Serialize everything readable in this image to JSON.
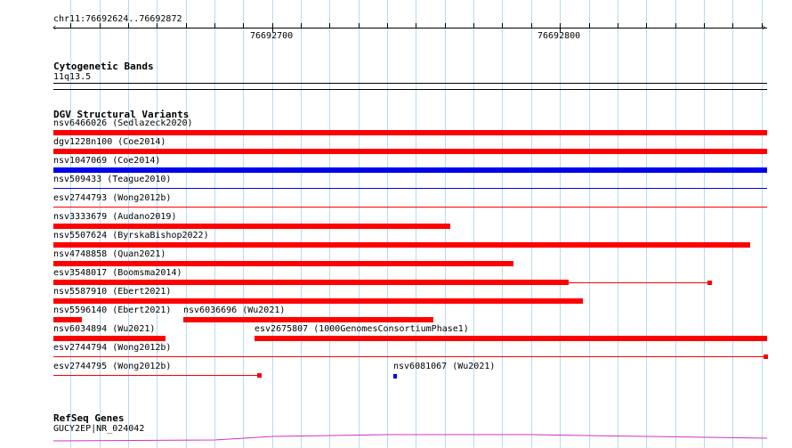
{
  "ruler": {
    "location": "chr11:76692624..76692872",
    "tick_labels": [
      "76692700",
      "76692800"
    ],
    "range": [
      76692624,
      76692872
    ]
  },
  "colors": {
    "grid": "#b5dcee",
    "gain": "#ff0000",
    "loss": "#0000ee",
    "gene": "#cc33cc"
  },
  "cytoband": {
    "title": "Cytogenetic Bands",
    "band": "11q13.5"
  },
  "dgv": {
    "title": "DGV Structural Variants",
    "features": [
      {
        "label": "nsv6466026 (Sedlazeck2020)",
        "start": 76692624,
        "end": 76692872,
        "style": "thick",
        "color": "#ff0000",
        "row": 0
      },
      {
        "label": "dgv1228n100 (Coe2014)",
        "start": 76692624,
        "end": 76692872,
        "style": "thick",
        "color": "#ff0000",
        "row": 1
      },
      {
        "label": "nsv1047069 (Coe2014)",
        "start": 76692624,
        "end": 76692872,
        "style": "thick",
        "color": "#0000ee",
        "row": 2
      },
      {
        "label": "nsv509433 (Teague2010)",
        "start": 76692624,
        "end": 76692872,
        "style": "thin",
        "color": "#0000ee",
        "row": 3
      },
      {
        "label": "esv2744793 (Wong2012b)",
        "start": 76692624,
        "end": 76692872,
        "style": "thin",
        "color": "#ff0000",
        "row": 4
      },
      {
        "label": "nsv3333679 (Audano2019)",
        "start": 76692624,
        "end": 76692762,
        "style": "thick",
        "color": "#ff0000",
        "row": 5
      },
      {
        "label": "nsv5507624 (ByrskaBishop2022)",
        "start": 76692624,
        "end": 76692866,
        "style": "thick",
        "color": "#ff0000",
        "row": 6
      },
      {
        "label": "nsv4748858 (Quan2021)",
        "start": 76692624,
        "end": 76692784,
        "style": "thick",
        "color": "#ff0000",
        "row": 7
      },
      {
        "label": "esv3548017 (Boomsma2014)",
        "start": 76692624,
        "end": 76692803,
        "style": "thick",
        "color": "#ff0000",
        "row": 8,
        "tail_end": 76692852
      },
      {
        "label": "nsv5587910 (Ebert2021)",
        "start": 76692624,
        "end": 76692808,
        "style": "thick",
        "color": "#ff0000",
        "row": 9
      },
      {
        "label": "nsv5596140 (Ebert2021)",
        "start": 76692624,
        "end": 76692634,
        "style": "thick",
        "color": "#ff0000",
        "row": 10
      },
      {
        "label": "nsv6036696 (Wu2021)",
        "start": 76692669,
        "end": 76692756,
        "style": "thick",
        "color": "#ff0000",
        "row": 10
      },
      {
        "label": "nsv6034894 (Wu2021)",
        "start": 76692624,
        "end": 76692663,
        "style": "thick",
        "color": "#ff0000",
        "row": 11
      },
      {
        "label": "esv2675807 (1000GenomesConsortiumPhase1)",
        "start": 76692694,
        "end": 76692872,
        "style": "thick",
        "color": "#ff0000",
        "row": 11
      },
      {
        "label": "esv2744794 (Wong2012b)",
        "start": 76692624,
        "end": 76692872,
        "style": "thin",
        "color": "#ff0000",
        "row": 12,
        "end_box": true
      },
      {
        "label": "esv2744795 (Wong2012b)",
        "start": 76692624,
        "end": 76692696,
        "style": "thin",
        "color": "#ff0000",
        "row": 13,
        "end_box": true
      },
      {
        "label": "nsv6081067 (Wu2021)",
        "start": 76692742,
        "end": 76692743,
        "style": "box",
        "color": "#0000ee",
        "row": 13
      }
    ]
  },
  "refseq": {
    "title": "RefSeq Genes",
    "gene_label": "GUCY2EP|NR_024042"
  }
}
